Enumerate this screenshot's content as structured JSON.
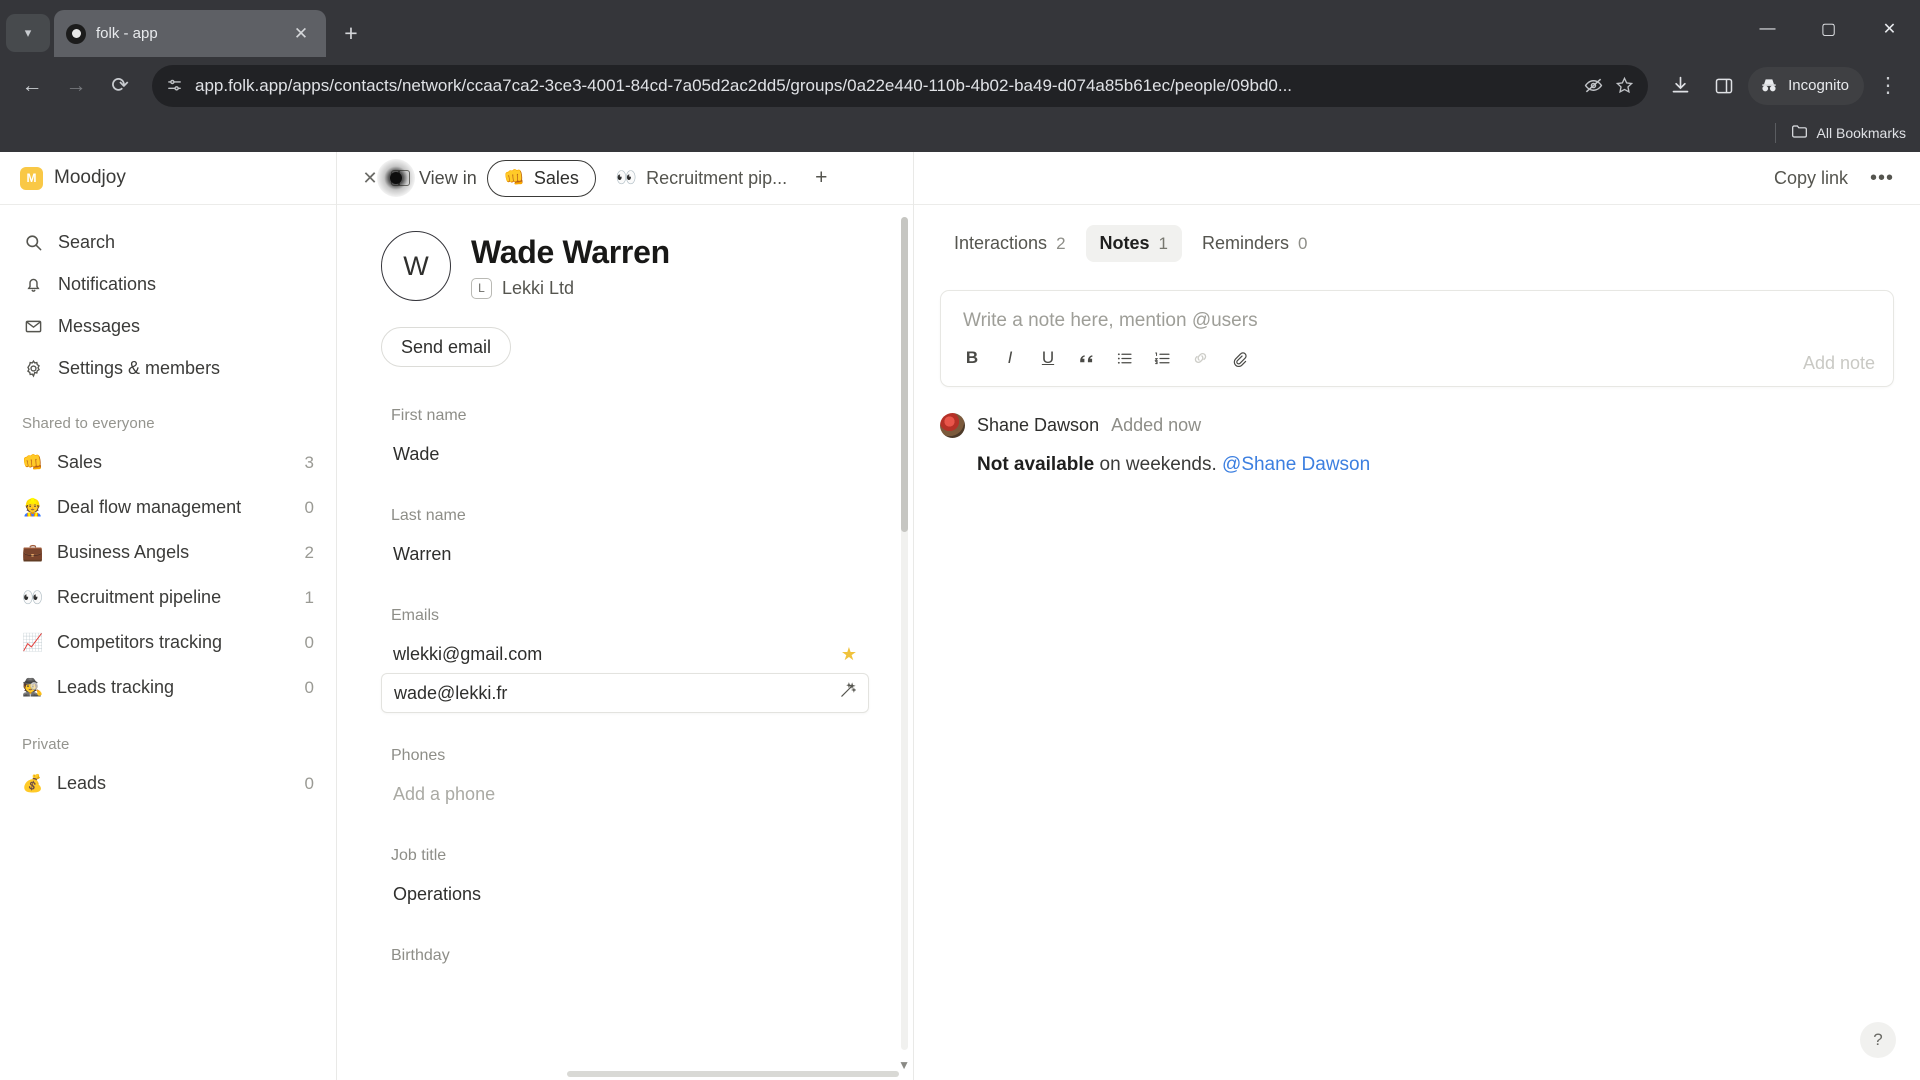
{
  "browser": {
    "tab_title": "folk - app",
    "url": "app.folk.app/apps/contacts/network/ccaa7ca2-3ce3-4001-84cd-7a05d2ac2dd5/groups/0a22e440-110b-4b02-ba49-d074a85b61ec/people/09bd0...",
    "incognito_label": "Incognito",
    "bookmarks_label": "All Bookmarks",
    "new_tab_glyph": "+",
    "close_tab_glyph": "✕",
    "back_glyph": "←",
    "forward_glyph": "→",
    "reload_glyph": "⟳",
    "minimize_glyph": "—",
    "maximize_glyph": "▢",
    "close_glyph": "✕",
    "menu_glyph": "⋮"
  },
  "sidebar": {
    "workspace": {
      "name": "Moodjoy",
      "initial": "M"
    },
    "nav": [
      {
        "label": "Search",
        "icon": "search-icon",
        "glyph": "⌕"
      },
      {
        "label": "Notifications",
        "icon": "bell-icon",
        "glyph": "🔔"
      },
      {
        "label": "Messages",
        "icon": "mail-icon",
        "glyph": "✉"
      },
      {
        "label": "Settings & members",
        "icon": "gear-icon",
        "glyph": "⚙"
      }
    ],
    "shared_section_label": "Shared to everyone",
    "shared_groups": [
      {
        "label": "Sales",
        "emoji": "👊",
        "count": "3"
      },
      {
        "label": "Deal flow management",
        "emoji": "👷",
        "count": "0"
      },
      {
        "label": "Business Angels",
        "emoji": "💼",
        "count": "2"
      },
      {
        "label": "Recruitment pipeline",
        "emoji": "👀",
        "count": "1"
      },
      {
        "label": "Competitors tracking",
        "emoji": "📈",
        "count": "0"
      },
      {
        "label": "Leads tracking",
        "emoji": "🕵",
        "count": "0"
      }
    ],
    "private_section_label": "Private",
    "private_groups": [
      {
        "label": "Leads",
        "emoji": "💰",
        "count": "0"
      }
    ]
  },
  "contact_panel": {
    "close_glyph": "✕",
    "view_in_label": "View in",
    "chips": [
      {
        "label": "Sales",
        "emoji": "👊",
        "selected": true
      },
      {
        "label": "Recruitment pip...",
        "emoji": "👀",
        "selected": false
      }
    ],
    "add_view_glyph": "+",
    "avatar_initial": "W",
    "name": "Wade Warren",
    "company": "Lekki Ltd",
    "company_initial": "L",
    "send_email_label": "Send email",
    "fields": [
      {
        "label": "First name",
        "value": "Wade",
        "type": "text"
      },
      {
        "label": "Last name",
        "value": "Warren",
        "type": "text"
      },
      {
        "label": "Emails",
        "type": "emails",
        "items": [
          {
            "value": "wlekki@gmail.com",
            "primary": true,
            "hovered": false
          },
          {
            "value": "wade@lekki.fr",
            "primary": false,
            "hovered": true
          }
        ]
      },
      {
        "label": "Phones",
        "value": "Add a phone",
        "type": "placeholder"
      },
      {
        "label": "Job title",
        "value": "Operations",
        "type": "text"
      },
      {
        "label": "Birthday",
        "value": "",
        "type": "text"
      }
    ],
    "star_glyph": "★",
    "wand_glyph": "🪄"
  },
  "right_panel": {
    "copy_link_label": "Copy link",
    "more_glyph": "•••",
    "tabs": [
      {
        "label": "Interactions",
        "count": "2",
        "active": false
      },
      {
        "label": "Notes",
        "count": "1",
        "active": true
      },
      {
        "label": "Reminders",
        "count": "0",
        "active": false
      }
    ],
    "editor": {
      "placeholder": "Write a note here, mention @users",
      "add_note_label": "Add note",
      "toolbar": [
        {
          "name": "bold-icon",
          "glyph": "B",
          "disabled": false
        },
        {
          "name": "italic-icon",
          "glyph": "I",
          "disabled": false
        },
        {
          "name": "underline-icon",
          "glyph": "U",
          "disabled": false
        },
        {
          "name": "quote-icon",
          "glyph": "❞",
          "disabled": false
        },
        {
          "name": "bullet-list-icon",
          "glyph": "☰",
          "disabled": false
        },
        {
          "name": "numbered-list-icon",
          "glyph": "≡",
          "disabled": false
        },
        {
          "name": "link-icon",
          "glyph": "⛓",
          "disabled": true
        },
        {
          "name": "attachment-icon",
          "glyph": "📎",
          "disabled": false
        }
      ]
    },
    "notes": [
      {
        "author": "Shane Dawson",
        "time": "Added now",
        "body_bold": "Not available",
        "body_rest": " on weekends. ",
        "mention": "@Shane Dawson"
      }
    ],
    "help_glyph": "?"
  }
}
